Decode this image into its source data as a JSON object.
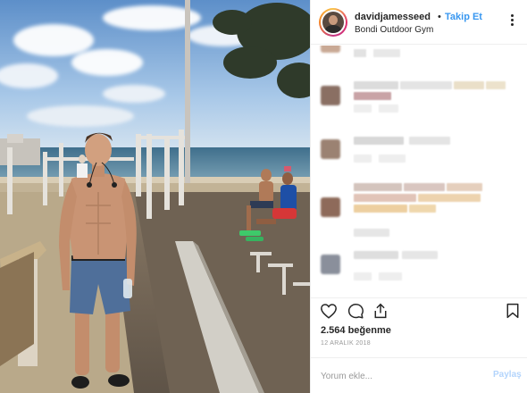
{
  "header": {
    "username": "davidjamesseed",
    "separator": "•",
    "follow_label": "Takip Et",
    "location": "Bondi Outdoor Gym"
  },
  "photo": {
    "description_icon": "photo"
  },
  "actions": {
    "icons": [
      "heart-icon",
      "comment-icon",
      "share-icon",
      "bookmark-icon"
    ]
  },
  "stats": {
    "likes": "2.564 beğenme",
    "date": "12 ARALIK 2018"
  },
  "comment_box": {
    "placeholder": "Yorum ekle...",
    "post_label": "Paylaş"
  },
  "colors": {
    "accent": "#3897f0",
    "post_disabled": "#b3d4fc",
    "text": "#262626",
    "muted": "#999999"
  }
}
